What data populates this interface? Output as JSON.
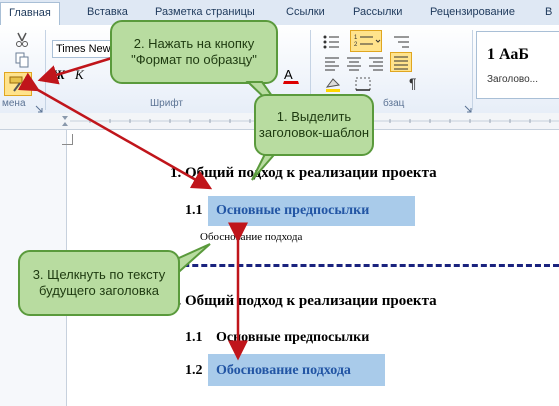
{
  "ribbon": {
    "tabs": [
      "Главная",
      "Вставка",
      "Разметка страницы",
      "Ссылки",
      "Рассылки",
      "Рецензирование",
      "В"
    ],
    "active_tab": "Главная",
    "font_name": "Times New",
    "groups": {
      "clipboard": "мена",
      "font": "Шрифт",
      "paragraph": "бзац"
    },
    "styles": {
      "sample": "1 АаБ",
      "name": "Заголово..."
    }
  },
  "document": {
    "heading1_top": {
      "num": "1.",
      "text": "Общий подход к реализации проекта"
    },
    "heading2_top": {
      "num": "1.1",
      "text": "Основные предпосылки"
    },
    "body_text": "Обоснование подхода",
    "heading1_bottom": {
      "num": "1.",
      "text": "Общий подход к реализации проекта"
    },
    "heading2_a": {
      "num": "1.1",
      "text": "Основные предпосылки"
    },
    "heading2_b": {
      "num": "1.2",
      "text": "Обоснование подхода"
    }
  },
  "callouts": {
    "step2": "2. Нажать на кнопку \"Формат по образцу\"",
    "step1": "1. Выделить заголовок-шаблон",
    "step3": "3. Щелкнуть по тексту будущего заголовка"
  },
  "colors": {
    "callout_fill": "#b8dca0",
    "callout_border": "#5a9a3c",
    "arrow": "#c0151b",
    "highlight": "#a9cbea",
    "heading_blue": "#2255a4"
  }
}
